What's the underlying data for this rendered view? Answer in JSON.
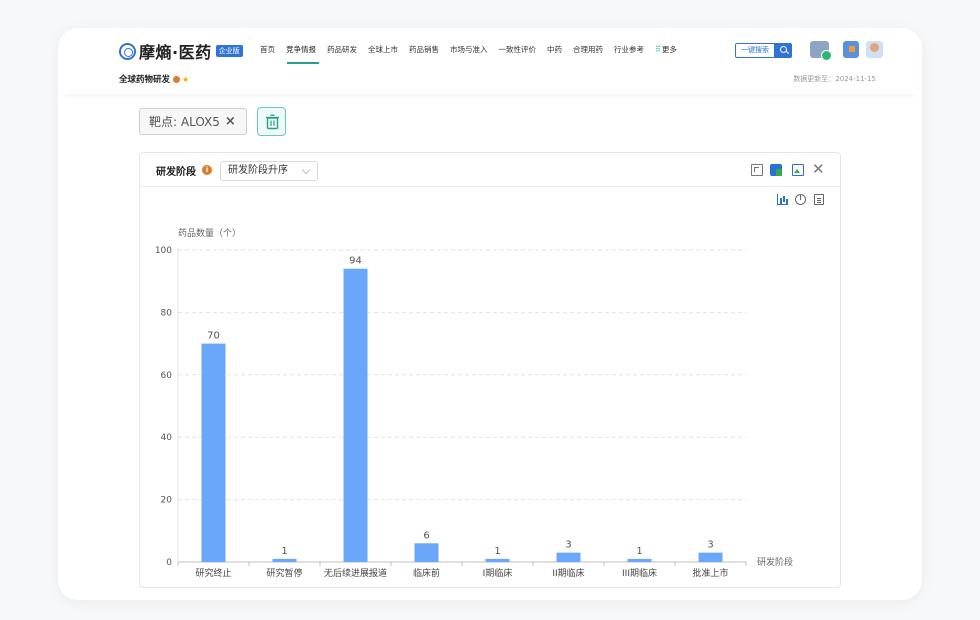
{
  "app": {
    "logo_text": "摩熵·医药",
    "logo_badge": "企业版"
  },
  "nav": {
    "items": [
      "首页",
      "竞争情报",
      "药品研发",
      "全球上市",
      "药品销售",
      "市场与准入",
      "一致性评价",
      "中药",
      "合理用药",
      "行业参考",
      "更多"
    ],
    "active_index": 1
  },
  "search": {
    "button_label": "一键搜索"
  },
  "page": {
    "subtitle": "全球药物研发",
    "update_label": "数据更新至：2024-11-15"
  },
  "filter": {
    "chip_label": "靶点: ALOX5",
    "chip_close": "×"
  },
  "panel": {
    "title": "研发阶段",
    "info": "i",
    "sort_value": "研发阶段升序",
    "close": "✕"
  },
  "colors": {
    "bar": "#6aa7fb",
    "accent": "#2a9d8f",
    "brand": "#2f73d8"
  },
  "chart_data": {
    "type": "bar",
    "ylabel": "药品数量（个）",
    "xlabel": "研发阶段",
    "categories": [
      "研究终止",
      "研究暂停",
      "无后续进展报道",
      "临床前",
      "I期临床",
      "II期临床",
      "III期临床",
      "批准上市"
    ],
    "values": [
      70,
      1,
      94,
      6,
      1,
      3,
      1,
      3
    ],
    "ylim": [
      0,
      100
    ],
    "yticks": [
      0,
      20,
      40,
      60,
      80,
      100
    ],
    "grid": true
  }
}
